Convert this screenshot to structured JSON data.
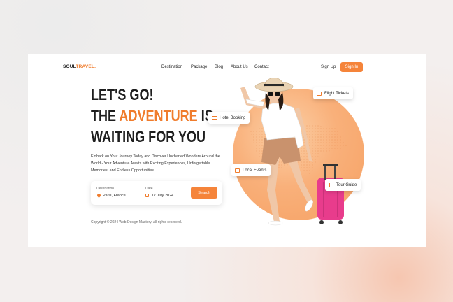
{
  "logo": {
    "part1": "SOUL",
    "part2": "TRAVEL."
  },
  "nav": [
    "Destination",
    "Package",
    "Blog",
    "About Us",
    "Contact"
  ],
  "auth": {
    "signup": "Sign Up",
    "signin": "Sign In"
  },
  "hero": {
    "line1": "LET'S GO!",
    "line2a": "THE ",
    "line2b": "ADVENTURE",
    "line2c": " IS",
    "line3": "WAITING FOR YOU",
    "description": "Embark on Your Journey Today and Discover Uncharted Wonders Around the World - Your Adventure Awaits with Exciting Experiences, Unforgettable Memories, and Endless Opportunities"
  },
  "search": {
    "destination_label": "Destination",
    "destination_value": "Paris, France",
    "date_label": "Date",
    "date_value": "17 July 2024",
    "button": "Search"
  },
  "tags": {
    "flight": "Flight Tickets",
    "hotel": "Hotel Booking",
    "events": "Local Events",
    "guide": "Tour Guide"
  },
  "footer": {
    "copyright": "Copyright © 2024 Web Design Mastery. All rights reserved."
  },
  "colors": {
    "accent": "#f5843a",
    "globe": "#f9b07a"
  }
}
